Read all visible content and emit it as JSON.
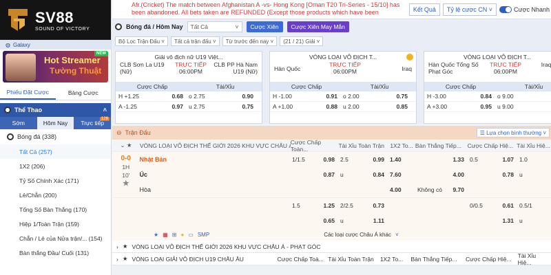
{
  "brand": {
    "name": "SV88",
    "tagline": "SOUND OF VICTORY"
  },
  "sidebar": {
    "galaxy": "Galaxy",
    "banner": {
      "line1": "Hot Streamer",
      "line2": "Tường Thuật",
      "badge": "NEW"
    },
    "tabs": [
      {
        "label": "Phiếu Đặt Cược"
      },
      {
        "label": "Bảng Cược"
      }
    ],
    "sport_header": "Thể Thao",
    "sub_tabs": [
      {
        "label": "Sớm"
      },
      {
        "label": "Hôm Nay"
      },
      {
        "label": "Trực tiếp",
        "count": "126"
      }
    ],
    "sport": "Bóng đá (338)",
    "items": [
      "Tất Cả (257)",
      "1X2 (206)",
      "Tỷ Số Chính Xác (171)",
      "Lẻ/Chẵn (200)",
      "Tổng Số Bàn Thắng (170)",
      "Hiệp 1/Toàn Trận (159)",
      "Chẵn / Lẻ của Nửa trận/...  (154)",
      "Bàn thắng Đầu/ Cuối (131)"
    ]
  },
  "ticker": "Afr.(Cricket) The match between Afghanistan A -vs- Hong Kong [Oman T20 Tri-Series - 15/10] has been abandoned. All bets taken are REFUNDED (Except those products which have been determined",
  "top": {
    "results_btn": "Kết Quả",
    "odds_btn": "Tỷ lệ cược CN ˅",
    "toggle": "Cược Nhanh"
  },
  "toolbar": {
    "title": "Bóng đá / Hôm Nay",
    "select_all": "Tất Cả",
    "btn_parlay": "Cược Xiên",
    "btn_lucky": "Cược Xiên May Mắn",
    "filters": [
      "Bộ Lọc Trận Đấu ˅",
      "Tất cả trận đấu ˅",
      "Từ trước đến nay ˅",
      "(21 / 21) Giải ˅"
    ]
  },
  "cards": [
    {
      "league": "Giải vô địch nữ U19 Việt...",
      "home": "CLB Sơn La U19 (Nữ)",
      "away": "CLB PP Hà Nam U19 (Nữ)",
      "status": "TRỰC TIẾP",
      "time": "06:00PM",
      "hdr": [
        "Cược Chấp",
        "Tài/Xỉu"
      ],
      "rows": [
        [
          "H +1.25",
          "0.68",
          "o 2.75",
          "0.90"
        ],
        [
          "A -1.25",
          "0.97",
          "u 2.75",
          "0.75"
        ]
      ]
    },
    {
      "league": "VÒNG LOẠI VÔ ĐỊCH T...",
      "home": "Hàn Quốc",
      "away": "Iraq",
      "status": "TRỰC TIẾP",
      "time": "06:00PM",
      "hdr": [
        "Cược Chấp",
        "Tài/Xỉu"
      ],
      "rows": [
        [
          "H -1.00",
          "0.91",
          "o 2.00",
          "0.75"
        ],
        [
          "A +1.00",
          "0.88",
          "u 2.00",
          "0.85"
        ]
      ]
    },
    {
      "league": "VÒNG LOẠI VÔ ĐỊCH T...",
      "home": "Hàn Quốc Tổng Số Phạt Góc",
      "away": "Iraq Tổng",
      "status": "TRỰC TIẾP",
      "time": "06:00PM",
      "hdr": [
        "Cược Chấp",
        "Tài/Xỉu"
      ],
      "rows": [
        [
          "H -3.00",
          "0.84",
          "o 9.00",
          ""
        ],
        [
          "A +3.00",
          "0.95",
          "u 9.00",
          ""
        ]
      ]
    }
  ],
  "match_bar": {
    "label": "Trận Đấu",
    "sort": "Lựa chọn bình thường ˅"
  },
  "grid": {
    "league": "VÒNG LOẠI VÔ ĐỊCH THẾ GIỚI 2026 KHU VỰC CHÂU Á",
    "heads": [
      "Cược Chấp Toàn...",
      "Tài Xỉu Toàn Trận",
      "1X2 To...",
      "Bàn Thắng Tiếp...",
      "Cược Chấp Hiệ...",
      "Tài Xỉu Hiệ..."
    ],
    "score": "0-0",
    "period": "1H",
    "minute": "10'",
    "home": "Nhật Bản",
    "away": "Úc",
    "draw": "Hòa",
    "rows": [
      [
        "1/1.5",
        "0.98",
        "2.5",
        "0.99",
        "1.40",
        "",
        "1.33",
        "0.5",
        "1.07",
        "1.0",
        ""
      ],
      [
        "",
        "0.87",
        "u",
        "0.84",
        "7.60",
        "",
        "4.00",
        "",
        "0.78",
        "u",
        ""
      ],
      [
        "",
        "",
        "",
        "",
        "4.00",
        "Không có",
        "9.70",
        "",
        "",
        "",
        ""
      ],
      [
        "1.5",
        "1.25",
        "2/2.5",
        "0.73",
        "",
        "",
        "",
        "0/0.5",
        "0.61",
        "0.5/1",
        ""
      ],
      [
        "",
        "0.65",
        "u",
        "1.11",
        "",
        "",
        "",
        "",
        "1.31",
        "u",
        ""
      ]
    ],
    "more": "Các loại cược Châu Á khác",
    "smp": "SMP"
  },
  "collapsed": [
    {
      "league": "VÒNG LOẠI VÔ ĐỊCH THẾ GIỚI 2026 KHU VỰC CHÂU Á - PHẠT GÓC"
    },
    {
      "league": "VÒNG LOẠI GIẢI VÔ ĐỊCH U19 CHÂU ÂU",
      "heads": [
        "Cược Chấp Toà...",
        "Tài Xỉu Toàn Trận",
        "1X2 To...",
        "Bàn Thắng Tiếp...",
        "Cược Chấp Hiệ...",
        "Tài Xỉu Hiệ..."
      ]
    }
  ]
}
